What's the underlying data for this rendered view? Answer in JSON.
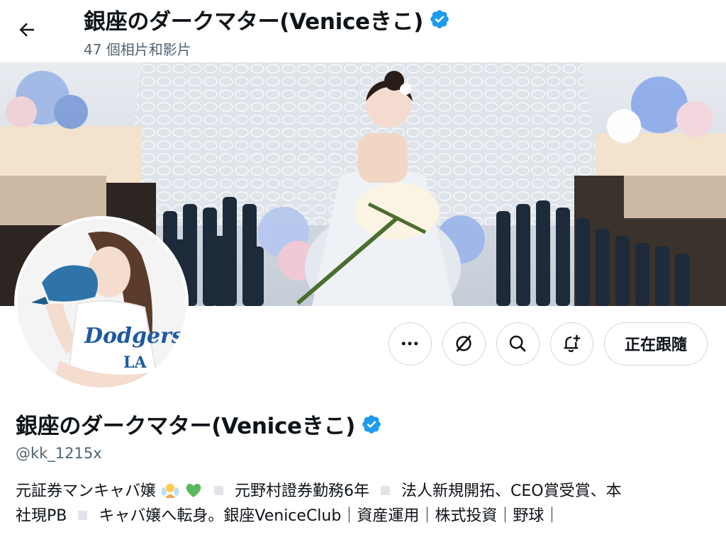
{
  "header": {
    "title": "銀座のダークマター(Veniceきこ)",
    "subtitle": "47 個相片和影片"
  },
  "profile": {
    "display_name": "銀座のダークマター(Veniceきこ)",
    "handle": "@kk_1215x",
    "bio": {
      "line1_a": "元証券マンキャバ嬢",
      "line1_b": "元野村證券勤務6年",
      "line1_c": "法人新規開拓、CEO賞受賞、本",
      "line2_a": "社現PB",
      "line2_b": "キャバ嬢へ転身。銀座VeniceClub｜資産運用｜株式投資｜野球｜"
    }
  },
  "actions": {
    "more_icon": "more-dots-icon",
    "grok_icon": "grok-icon",
    "search_icon": "search-icon",
    "notify_icon": "bell-plus-icon",
    "follow_label": "正在跟隨"
  },
  "colors": {
    "verified": "#1d9bf0",
    "text_primary": "#0f1419",
    "text_secondary": "#536471",
    "border": "#cfd9de"
  }
}
